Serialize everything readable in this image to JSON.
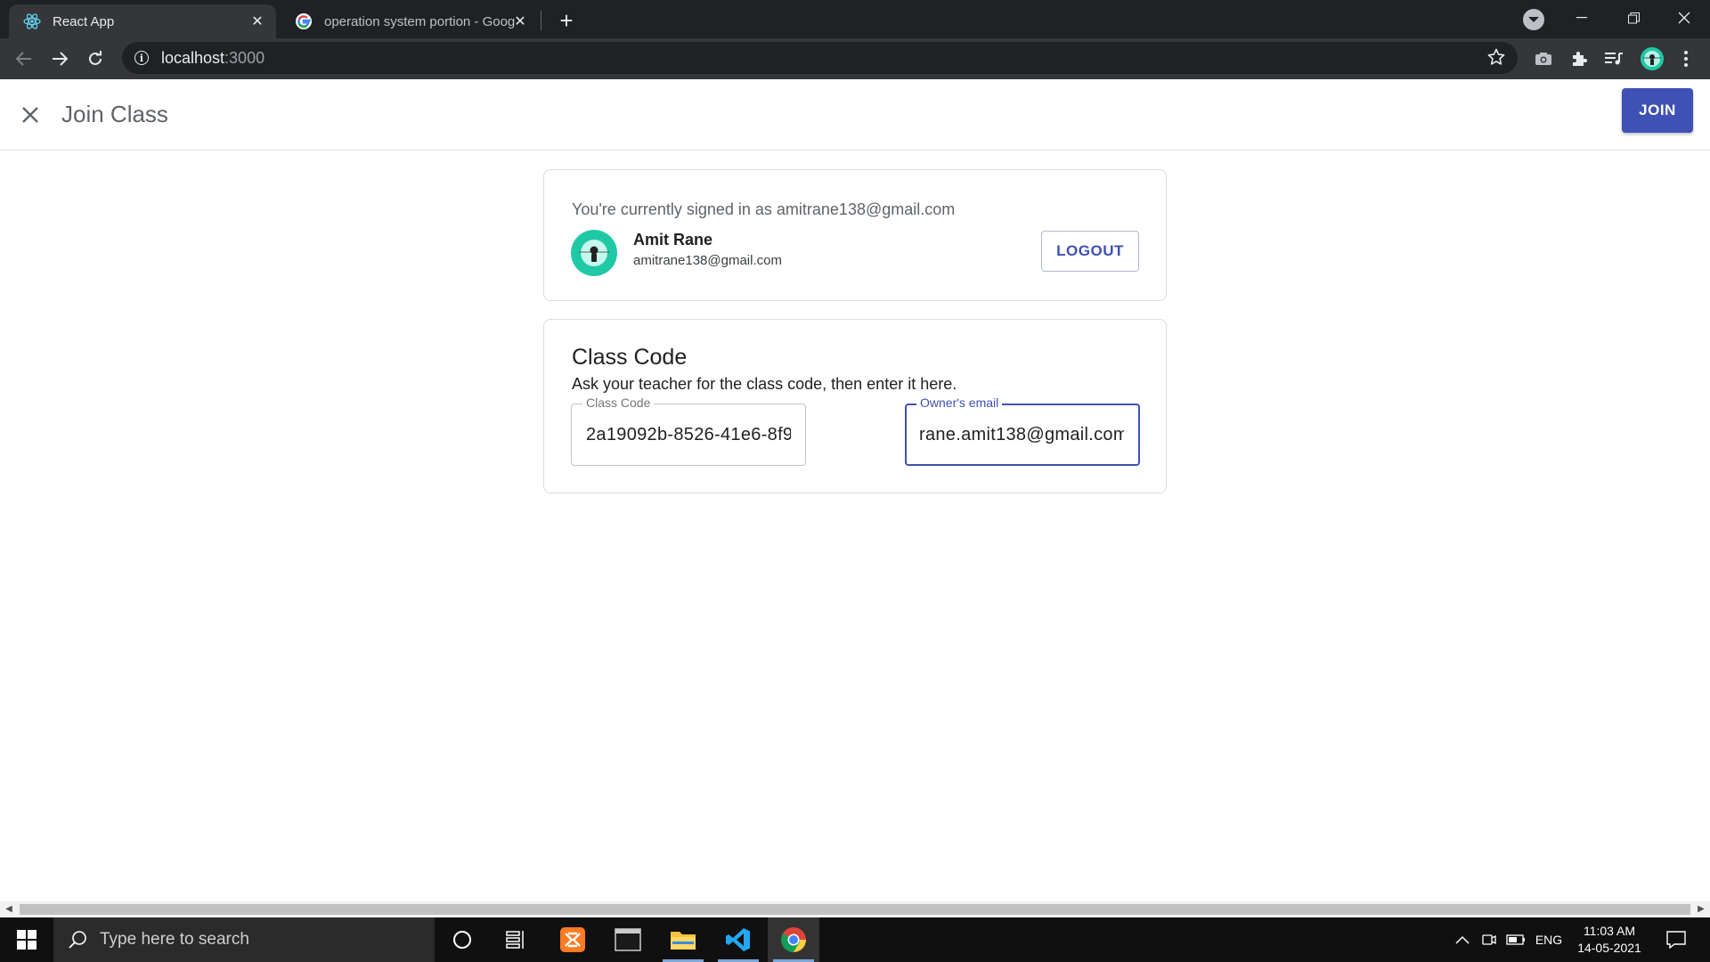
{
  "browser": {
    "tabs": [
      {
        "title": "React App",
        "active": true
      },
      {
        "title": "operation system portion - Goog",
        "active": false
      }
    ],
    "url_host": "localhost",
    "url_port": ":3000"
  },
  "header": {
    "title": "Join Class",
    "join_label": "JOIN"
  },
  "account_card": {
    "signed_in_text": "You're currently signed in as amitrane138@gmail.com",
    "user_name": "Amit Rane",
    "user_email": "amitrane138@gmail.com",
    "logout_label": "LOGOUT"
  },
  "class_card": {
    "title": "Class Code",
    "description": "Ask your teacher for the class code, then enter it here.",
    "code_label": "Class Code",
    "code_value": "2a19092b-8526-41e6-8f9",
    "email_label": "Owner's email",
    "email_value": "rane.amit138@gmail.com"
  },
  "taskbar": {
    "search_placeholder": "Type here to search",
    "language": "ENG",
    "time": "11:03 AM",
    "date": "14-05-2021"
  },
  "colors": {
    "primary": "#3f51b5",
    "avatar_bg": "#20c9a6",
    "chrome_dark": "#202124",
    "chrome_toolbar": "#35363a"
  },
  "icons": [
    "react-icon",
    "google-icon",
    "close-icon",
    "plus-icon",
    "back-icon",
    "forward-icon",
    "reload-icon",
    "info-icon",
    "star-icon",
    "camera-icon",
    "extensions-icon",
    "media-icon",
    "profile-icon",
    "menu-icon",
    "windows-icon",
    "search-icon",
    "cortana-icon",
    "taskview-icon",
    "xampp-icon",
    "terminal-icon",
    "folder-icon",
    "vscode-icon",
    "chrome-icon",
    "notification-icon"
  ]
}
